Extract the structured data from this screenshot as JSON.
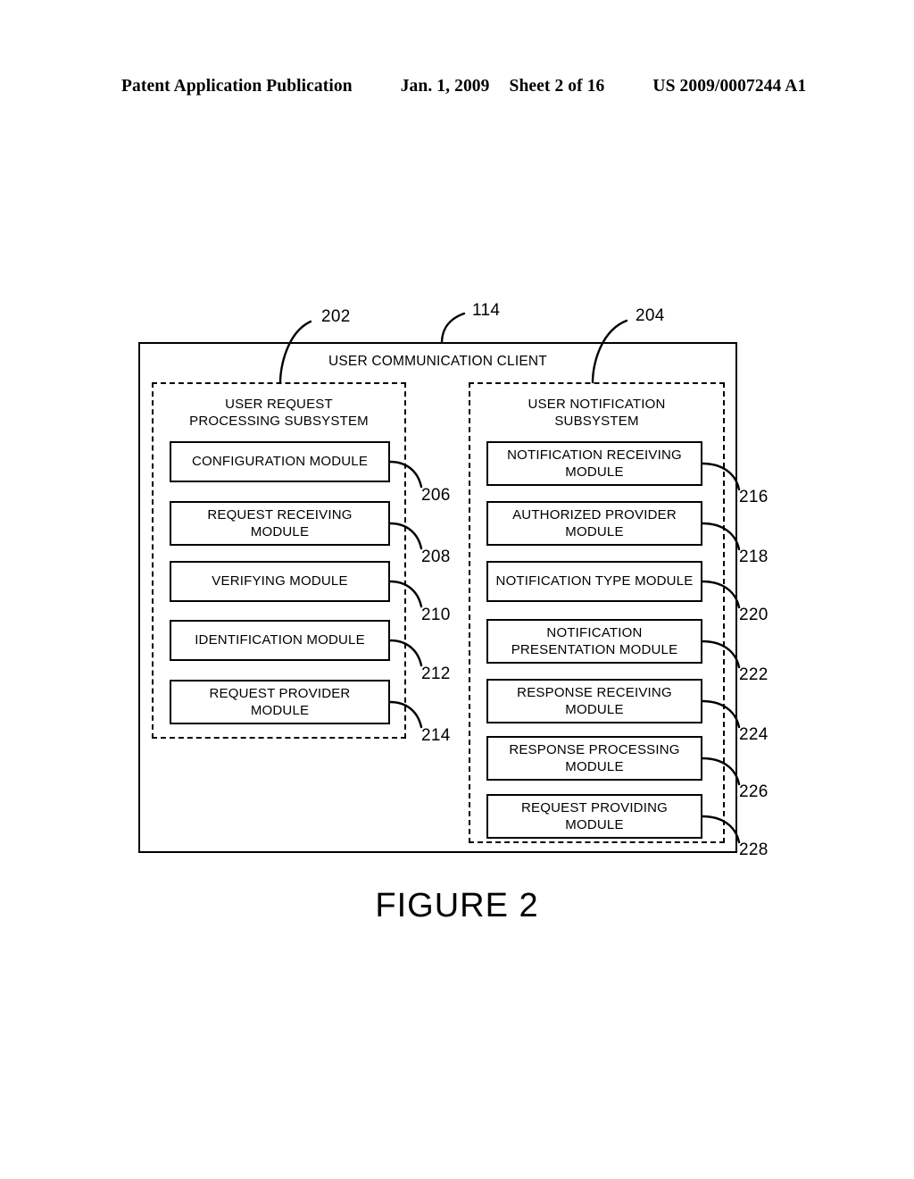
{
  "header": {
    "publication": "Patent Application Publication",
    "date": "Jan. 1, 2009",
    "sheet": "Sheet 2 of 16",
    "patent_number": "US 2009/0007244 A1"
  },
  "figure": {
    "caption": "FIGURE 2",
    "client_title": "USER COMMUNICATION CLIENT",
    "client_ref": "114",
    "left_subsystem": {
      "title": "USER REQUEST\nPROCESSING SUBSYSTEM",
      "ref": "202",
      "modules": [
        {
          "label": "CONFIGURATION MODULE",
          "ref": "206"
        },
        {
          "label": "REQUEST RECEIVING\nMODULE",
          "ref": "208"
        },
        {
          "label": "VERIFYING MODULE",
          "ref": "210"
        },
        {
          "label": "IDENTIFICATION MODULE",
          "ref": "212"
        },
        {
          "label": "REQUEST PROVIDER\nMODULE",
          "ref": "214"
        }
      ]
    },
    "right_subsystem": {
      "title": "USER NOTIFICATION\nSUBSYSTEM",
      "ref": "204",
      "modules": [
        {
          "label": "NOTIFICATION RECEIVING\nMODULE",
          "ref": "216"
        },
        {
          "label": "AUTHORIZED PROVIDER\nMODULE",
          "ref": "218"
        },
        {
          "label": "NOTIFICATION TYPE MODULE",
          "ref": "220"
        },
        {
          "label": "NOTIFICATION\nPRESENTATION MODULE",
          "ref": "222"
        },
        {
          "label": "RESPONSE RECEIVING\nMODULE",
          "ref": "224"
        },
        {
          "label": "RESPONSE PROCESSING\nMODULE",
          "ref": "226"
        },
        {
          "label": "REQUEST PROVIDING\nMODULE",
          "ref": "228"
        }
      ]
    }
  }
}
